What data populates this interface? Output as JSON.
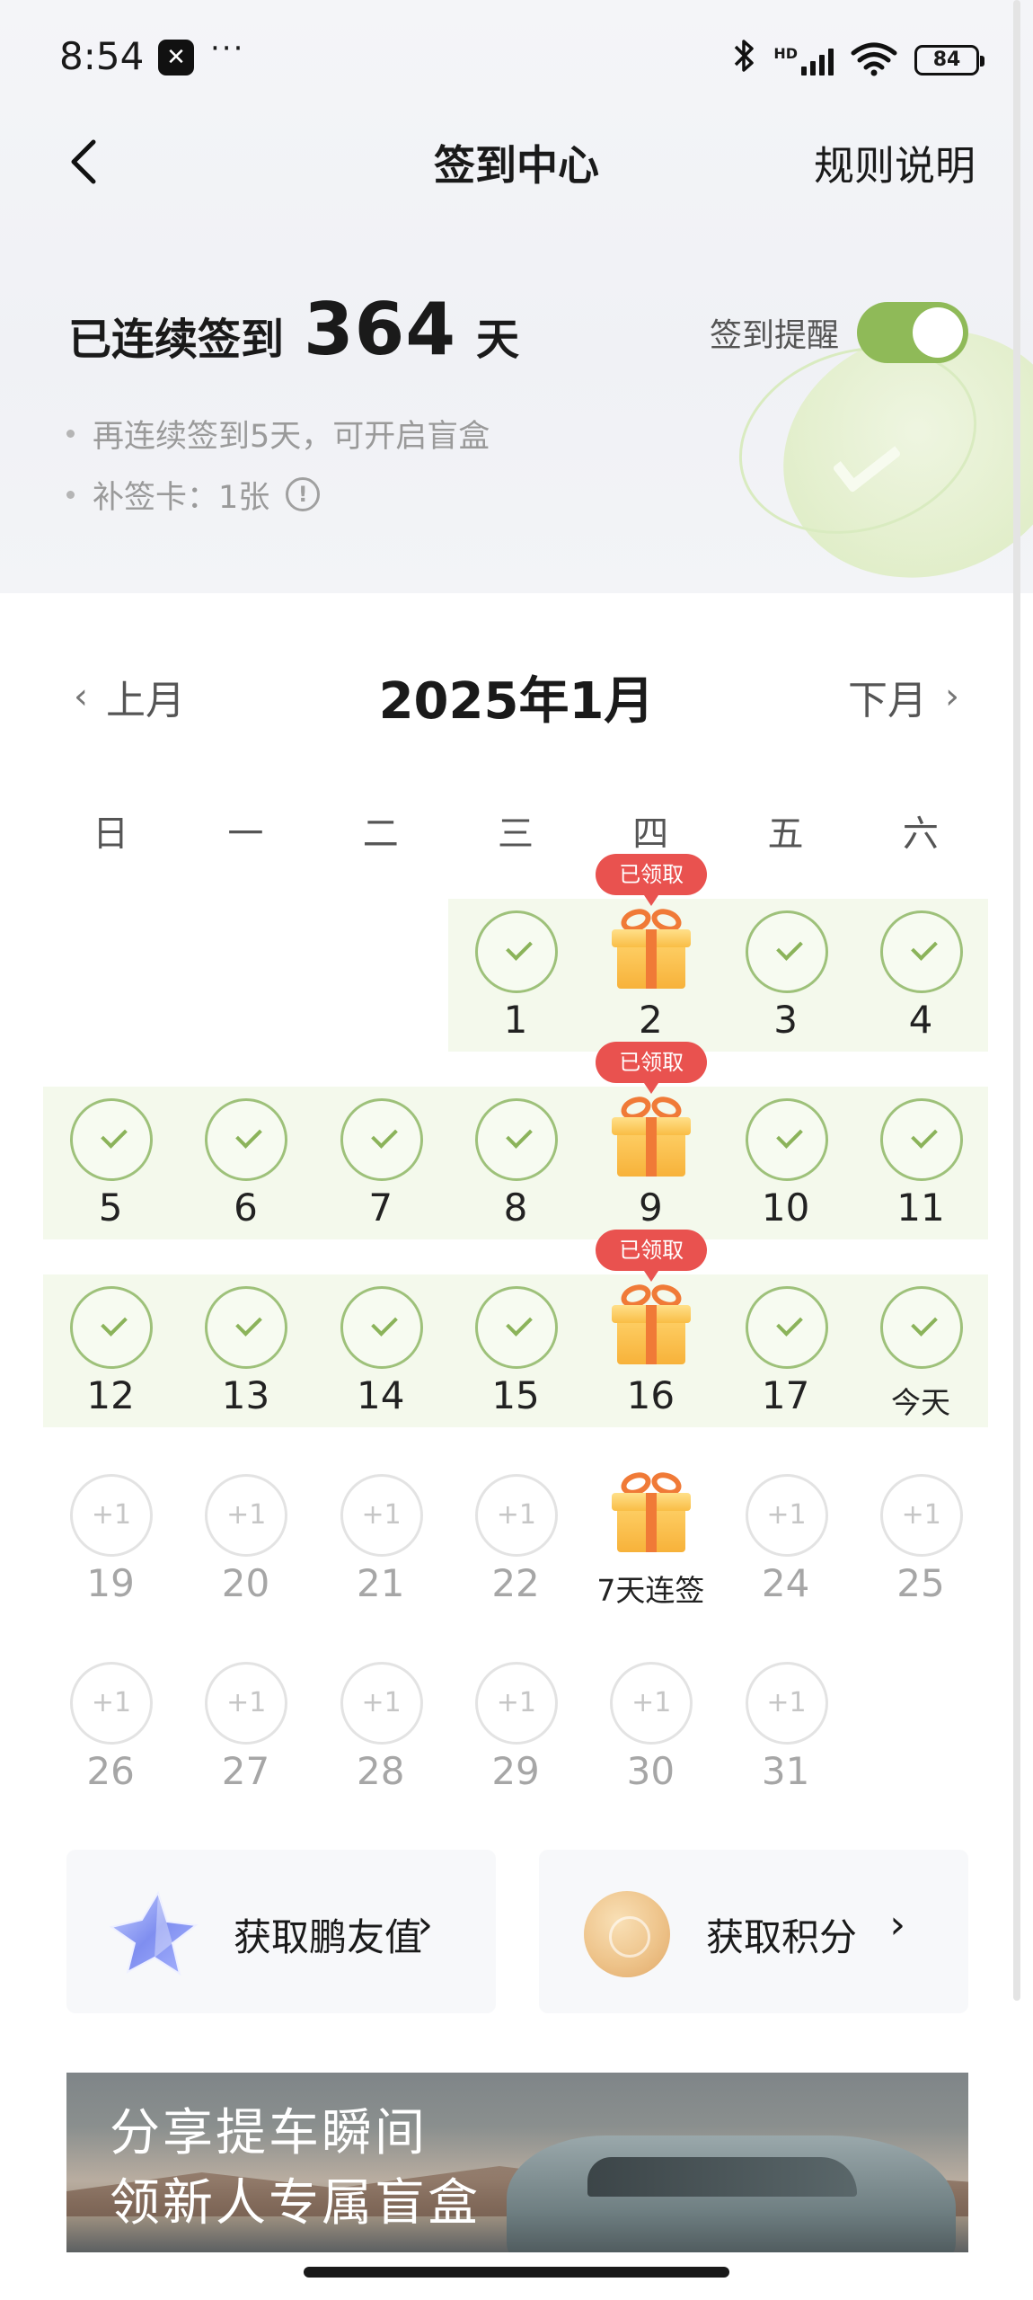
{
  "status_bar": {
    "time": "8:54",
    "app_icon": "x-app-icon",
    "more": "···",
    "icons": [
      "bluetooth-icon",
      "hd-signal-icon",
      "wifi-icon"
    ],
    "hd": "HD",
    "battery": "84"
  },
  "header": {
    "title": "签到中心",
    "rules_label": "规则说明"
  },
  "streak": {
    "prefix": "已连续签到",
    "days": "364",
    "suffix": "天"
  },
  "reminder": {
    "label": "签到提醒",
    "enabled": true
  },
  "tips": [
    "再连续签到5天，可开启盲盒",
    "补签卡：1张"
  ],
  "calendar": {
    "prev_label": "上月",
    "next_label": "下月",
    "month_title": "2025年1月",
    "weekdays": [
      "日",
      "一",
      "二",
      "三",
      "四",
      "五",
      "六"
    ],
    "claimed_badge": "已领取",
    "plus_one": "+1",
    "weeks": [
      [
        null,
        null,
        null,
        {
          "label": "1",
          "state": "done"
        },
        {
          "label": "2",
          "state": "gift-claimed"
        },
        {
          "label": "3",
          "state": "done"
        },
        {
          "label": "4",
          "state": "done"
        }
      ],
      [
        {
          "label": "5",
          "state": "done"
        },
        {
          "label": "6",
          "state": "done"
        },
        {
          "label": "7",
          "state": "done"
        },
        {
          "label": "8",
          "state": "done"
        },
        {
          "label": "9",
          "state": "gift-claimed"
        },
        {
          "label": "10",
          "state": "done"
        },
        {
          "label": "11",
          "state": "done"
        }
      ],
      [
        {
          "label": "12",
          "state": "done"
        },
        {
          "label": "13",
          "state": "done"
        },
        {
          "label": "14",
          "state": "done"
        },
        {
          "label": "15",
          "state": "done"
        },
        {
          "label": "16",
          "state": "gift-claimed"
        },
        {
          "label": "17",
          "state": "done"
        },
        {
          "label": "今天",
          "state": "done-today"
        }
      ],
      [
        {
          "label": "19",
          "state": "future"
        },
        {
          "label": "20",
          "state": "future"
        },
        {
          "label": "21",
          "state": "future"
        },
        {
          "label": "22",
          "state": "future"
        },
        {
          "label": "7天连签",
          "state": "gift-future"
        },
        {
          "label": "24",
          "state": "future"
        },
        {
          "label": "25",
          "state": "future"
        }
      ],
      [
        {
          "label": "26",
          "state": "future"
        },
        {
          "label": "27",
          "state": "future"
        },
        {
          "label": "28",
          "state": "future"
        },
        {
          "label": "29",
          "state": "future"
        },
        {
          "label": "30",
          "state": "future"
        },
        {
          "label": "31",
          "state": "future"
        },
        null
      ]
    ]
  },
  "cards": {
    "friend_value": "获取鹏友值",
    "points": "获取积分",
    "arrow": "›"
  },
  "banner": {
    "line1": "分享提车瞬间",
    "line2": "领新人专属盲盒"
  },
  "colors": {
    "accent_green": "#8fba58",
    "badge_red": "#e9524f",
    "gift_orange": "#f7b23a"
  }
}
